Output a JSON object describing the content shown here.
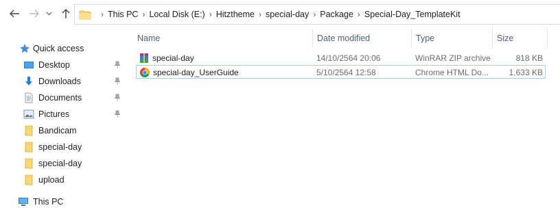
{
  "window": {
    "title": "Special-Day_TemplateKit"
  },
  "toolbar": {
    "back_icon": "arrow-left-icon",
    "forward_icon": "arrow-right-icon",
    "history_icon": "chevron-down-icon",
    "up_icon": "arrow-up-icon"
  },
  "breadcrumb": {
    "icon": "folder-icon",
    "items": [
      "This PC",
      "Local Disk (E:)",
      "Hitztheme",
      "special-day",
      "Package",
      "Special-Day_TemplateKit"
    ],
    "separator": ">"
  },
  "sidebar": {
    "items": [
      {
        "label": "Quick access",
        "icon": "star-icon",
        "pinned": false
      },
      {
        "label": "Desktop",
        "icon": "desktop-icon",
        "pinned": true
      },
      {
        "label": "Downloads",
        "icon": "download-icon",
        "pinned": true
      },
      {
        "label": "Documents",
        "icon": "documents-icon",
        "pinned": true
      },
      {
        "label": "Pictures",
        "icon": "pictures-icon",
        "pinned": true
      },
      {
        "label": "Bandicam",
        "icon": "folder-icon",
        "pinned": false
      },
      {
        "label": "special-day",
        "icon": "folder-icon",
        "pinned": false
      },
      {
        "label": "special-day",
        "icon": "folder-icon",
        "pinned": false
      },
      {
        "label": "upload",
        "icon": "folder-icon",
        "pinned": false
      },
      {
        "label": "This PC",
        "icon": "computer-icon",
        "pinned": false
      }
    ]
  },
  "columns": [
    "Name",
    "Date modified",
    "Type",
    "Size"
  ],
  "files": [
    {
      "name": "special-day",
      "date": "14/10/2564 20:06",
      "type": "WinRAR ZIP archive",
      "size": "818 KB",
      "icon": "winrar-archive-icon",
      "selected": false
    },
    {
      "name": "special-day_UserGuide",
      "date": "5/10/2564 12:58",
      "type": "Chrome HTML Do...",
      "size": "1,633 KB",
      "icon": "chrome-icon",
      "selected": true
    }
  ],
  "colors": {
    "accent": "#0078d7",
    "selection_border": "#99d1ff",
    "header_text": "#4c607a",
    "folder_yellow": "#f8d775"
  }
}
